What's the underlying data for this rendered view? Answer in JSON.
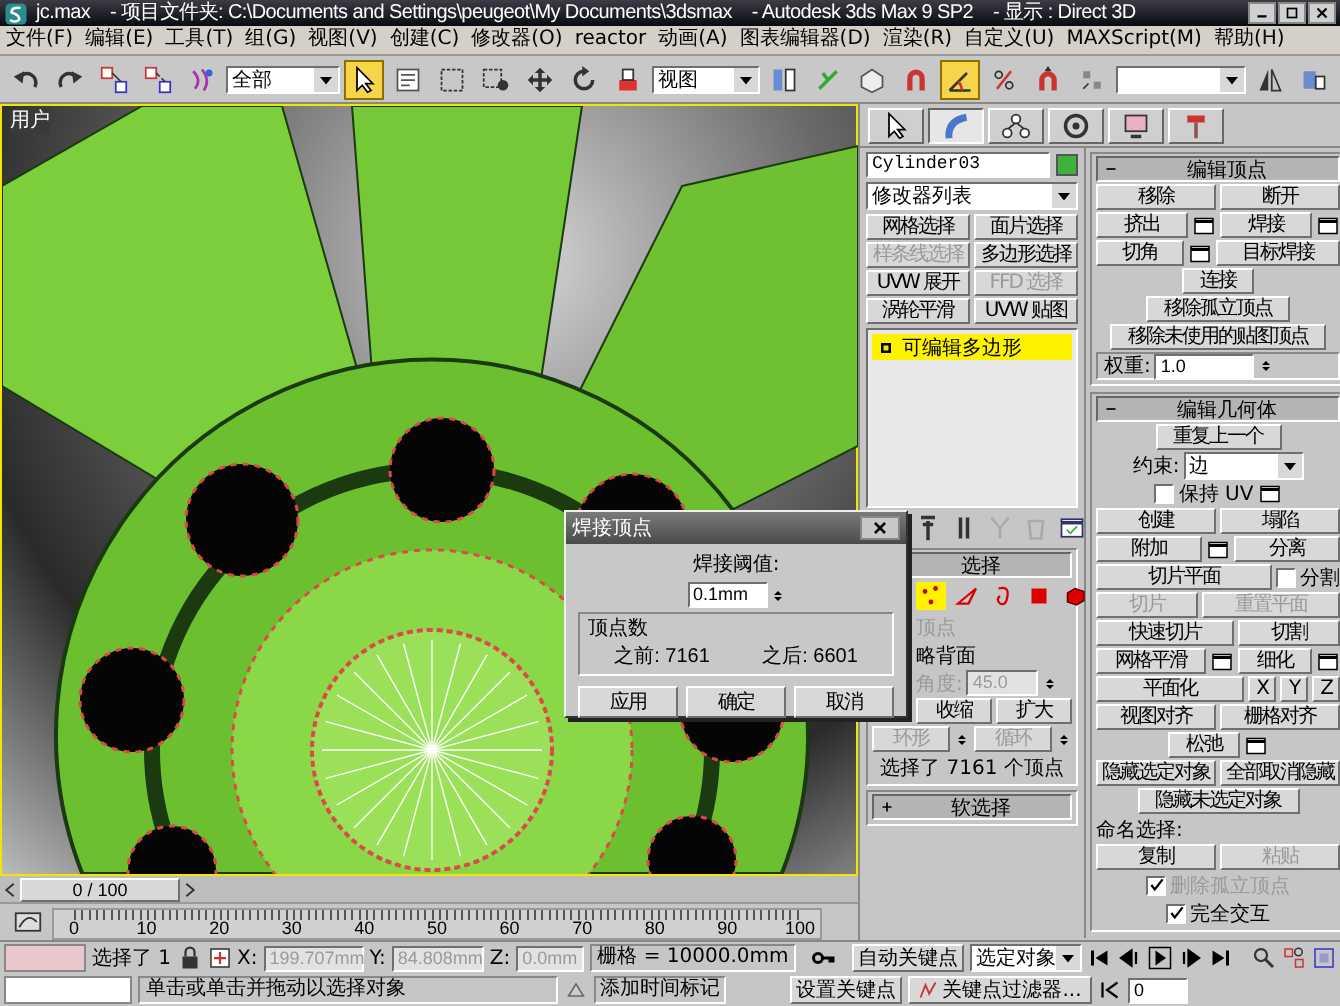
{
  "window": {
    "title": "jc.max    - 项目文件夹: C:\\Documents and Settings\\peugeot\\My Documents\\3dsmax    - Autodesk 3ds Max 9 SP2    - 显示 : Direct 3D"
  },
  "menu": [
    "文件(F)",
    "编辑(E)",
    "工具(T)",
    "组(G)",
    "视图(V)",
    "创建(C)",
    "修改器(O)",
    "reactor",
    "动画(A)",
    "图表编辑器(D)",
    "渲染(R)",
    "自定义(U)",
    "MAXScript(M)",
    "帮助(H)"
  ],
  "toolbar": {
    "items": [
      {
        "kind": "undo",
        "selected": false
      },
      {
        "kind": "redo",
        "selected": false
      },
      {
        "kind": "link",
        "selected": false
      },
      {
        "kind": "unlink",
        "selected": false
      },
      {
        "kind": "bind",
        "selected": false
      },
      {
        "kind": "dropdown",
        "value": "全部"
      },
      {
        "kind": "select",
        "selected": true
      },
      {
        "kind": "select-name",
        "selected": false
      },
      {
        "kind": "rect-region",
        "selected": false
      },
      {
        "kind": "crossing",
        "selected": false
      },
      {
        "kind": "move",
        "selected": false
      },
      {
        "kind": "rotate",
        "selected": false
      },
      {
        "kind": "scale",
        "selected": false
      },
      {
        "kind": "dropdown",
        "value": "视图"
      },
      {
        "kind": "pivot",
        "selected": false
      },
      {
        "kind": "manipulate",
        "selected": false
      },
      {
        "kind": "shortcut",
        "selected": false
      },
      {
        "kind": "snap",
        "selected": false
      },
      {
        "kind": "angle-snap",
        "selected": true
      },
      {
        "kind": "percent-snap",
        "selected": false
      },
      {
        "kind": "spinner-snap",
        "selected": false
      },
      {
        "kind": "named-sel",
        "selected": false
      },
      {
        "kind": "dropdown"
      },
      {
        "kind": "mirror",
        "selected": false
      },
      {
        "kind": "align",
        "selected": false
      }
    ]
  },
  "viewport": {
    "label": "用户"
  },
  "timeline": {
    "level": 0,
    "frame": "0 / 100",
    "ticks": [
      "0",
      "10",
      "20",
      "30",
      "40",
      "50",
      "60",
      "70",
      "80",
      "90",
      "100"
    ]
  },
  "command_panel": {
    "tabs": [
      {
        "kind": "create",
        "selected": false
      },
      {
        "kind": "modify",
        "selected": true
      },
      {
        "kind": "hierarchy",
        "selected": false
      },
      {
        "kind": "motion",
        "selected": false
      },
      {
        "kind": "display",
        "selected": false
      },
      {
        "kind": "utilities",
        "selected": false
      }
    ],
    "object_name": "Cylinder03",
    "modifier_list": "修改器列表",
    "modifier_buttons": [
      {
        "label": "网格选择",
        "disabled": false
      },
      {
        "label": "面片选择",
        "disabled": false
      },
      {
        "label": "样条线选择",
        "disabled": true
      },
      {
        "label": "多边形选择",
        "disabled": false
      },
      {
        "label": "UVW 展开",
        "disabled": false
      },
      {
        "label": "FFD 选择",
        "disabled": true
      },
      {
        "label": "涡轮平滑",
        "disabled": false
      },
      {
        "label": "UVW 贴图",
        "disabled": false
      }
    ],
    "stack": [
      {
        "label": "可编辑多边形",
        "selected": true
      }
    ],
    "selection": {
      "title": "选择",
      "expanded": true,
      "levels": [
        {
          "kind": "vertex",
          "selected": true
        },
        {
          "kind": "edge",
          "selected": false
        },
        {
          "kind": "border",
          "selected": false
        },
        {
          "kind": "polygon",
          "selected": false
        },
        {
          "kind": "element",
          "selected": false
        }
      ],
      "by_vertex": {
        "label": "顶点",
        "disabled": true
      },
      "ignore_backfacing": {
        "label": "略背面",
        "disabled": false
      },
      "angle": {
        "label": "角度:",
        "value": "45.0",
        "disabled": true
      },
      "button_rows": [
        [
          {
            "label": "收缩",
            "disabled": false,
            "spinner": false
          },
          {
            "label": "扩大",
            "disabled": false,
            "spinner": false
          }
        ],
        [
          {
            "label": "环形",
            "disabled": true,
            "spinner": true
          },
          {
            "label": "循环",
            "disabled": true,
            "spinner": true
          }
        ]
      ],
      "status": "选择了 7161 个顶点"
    },
    "soft_selection": {
      "title": "软选择",
      "expanded": false
    },
    "edit_vertices": {
      "title": "编辑顶点",
      "expanded": true,
      "rows": [
        [
          {
            "label": "移除",
            "settings": false,
            "disabled": false
          },
          {
            "label": "断开",
            "settings": false,
            "disabled": false
          }
        ],
        [
          {
            "label": "挤出",
            "settings": true,
            "disabled": false
          },
          {
            "label": "焊接",
            "settings": true,
            "disabled": false
          }
        ],
        [
          {
            "label": "切角",
            "settings": true,
            "disabled": false
          },
          {
            "label": "目标焊接",
            "settings": false,
            "disabled": false
          }
        ],
        [
          {
            "label": "连接",
            "settings": false,
            "disabled": false
          }
        ],
        [
          {
            "label": "移除孤立顶点",
            "settings": false,
            "disabled": false
          }
        ],
        [
          {
            "label": "移除未使用的贴图顶点",
            "settings": false,
            "disabled": false
          }
        ]
      ],
      "weight": {
        "label": "权重:",
        "value": "1.0"
      }
    },
    "edit_geometry": {
      "title": "编辑几何体",
      "expanded": true,
      "items": [
        {
          "kind": "buttons",
          "buttons": [
            {
              "label": "重复上一个",
              "settings": false,
              "disabled": false
            }
          ]
        },
        {
          "kind": "dropdown",
          "label": "约束:",
          "value": "边"
        },
        {
          "kind": "checkbox",
          "label": "保持 UV",
          "checked": false,
          "disabled": false,
          "settings": true
        },
        {
          "kind": "buttons",
          "buttons": [
            {
              "label": "创建",
              "settings": false,
              "disabled": false
            },
            {
              "label": "塌陷",
              "settings": false,
              "disabled": false
            }
          ]
        },
        {
          "kind": "buttons",
          "buttons": [
            {
              "label": "附加",
              "settings": true,
              "disabled": false
            },
            {
              "label": "分离",
              "settings": false,
              "disabled": false
            }
          ]
        },
        {
          "kind": "button-check",
          "label": "切片平面",
          "check_label": "分割",
          "checked": false
        },
        {
          "kind": "buttons",
          "buttons": [
            {
              "label": "切片",
              "settings": false,
              "disabled": true
            },
            {
              "label": "重置平面",
              "settings": false,
              "disabled": true
            }
          ]
        },
        {
          "kind": "buttons",
          "buttons": [
            {
              "label": "快速切片",
              "settings": false,
              "disabled": false
            },
            {
              "label": "切割",
              "settings": false,
              "disabled": false
            }
          ]
        },
        {
          "kind": "buttons",
          "buttons": [
            {
              "label": "网格平滑",
              "settings": true,
              "disabled": false
            },
            {
              "label": "细化",
              "settings": true,
              "disabled": false
            }
          ]
        },
        {
          "kind": "planarize",
          "label": "平面化",
          "axes": [
            "X",
            "Y",
            "Z"
          ]
        },
        {
          "kind": "buttons",
          "buttons": [
            {
              "label": "视图对齐",
              "settings": false,
              "disabled": false
            },
            {
              "label": "栅格对齐",
              "settings": false,
              "disabled": false
            }
          ]
        },
        {
          "kind": "buttons",
          "buttons": [
            {
              "label": "松弛",
              "settings": true,
              "disabled": false
            }
          ]
        },
        {
          "kind": "buttons",
          "buttons": [
            {
              "label": "隐藏选定对象",
              "settings": false,
              "disabled": false
            },
            {
              "label": "全部取消隐藏",
              "settings": false,
              "disabled": false
            }
          ]
        },
        {
          "kind": "buttons",
          "buttons": [
            {
              "label": "隐藏未选定对象",
              "settings": false,
              "disabled": false
            }
          ]
        },
        {
          "kind": "label",
          "text": "命名选择:"
        },
        {
          "kind": "buttons",
          "buttons": [
            {
              "label": "复制",
              "settings": false,
              "disabled": false
            },
            {
              "label": "粘贴",
              "settings": false,
              "disabled": true
            }
          ]
        },
        {
          "kind": "checkbox",
          "label": "删除孤立顶点",
          "checked": true,
          "disabled": true,
          "settings": false
        },
        {
          "kind": "checkbox",
          "label": "完全交互",
          "checked": true,
          "disabled": false,
          "settings": false
        }
      ]
    }
  },
  "dialog": {
    "title": "焊接顶点",
    "threshold_label": "焊接阈值:",
    "threshold": "0.1mm",
    "group_title": "顶点数",
    "before": "之前: 7161",
    "after": "之后: 6601",
    "buttons": [
      "应用",
      "确定",
      "取消"
    ]
  },
  "status_bar": {
    "selection_count": "选择了 1",
    "x": {
      "label": "X:",
      "value": "199.707mm",
      "disabled": true
    },
    "y": {
      "label": "Y:",
      "value": "84.808mm",
      "disabled": true
    },
    "z": {
      "label": "Z:",
      "value": "0.0mm",
      "disabled": true
    },
    "grid": "栅格 = 10000.0mm",
    "auto_key": "自动关键点",
    "key_mode": "选定对象",
    "prompt": "单击或单击并拖动以选择对象",
    "time_tag": "添加时间标记",
    "set_key": "设置关键点",
    "key_filters": "关键点过滤器...",
    "current_frame": "0"
  }
}
